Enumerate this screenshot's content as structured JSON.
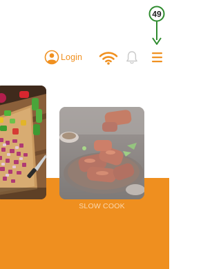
{
  "annotation": {
    "number": "49"
  },
  "header": {
    "login_label": "Login",
    "icons": [
      "user-circle-icon",
      "wifi-icon",
      "bell-icon",
      "hamburger-menu-icon"
    ]
  },
  "cards": [
    {
      "label": ""
    },
    {
      "label": "SLOW COOK"
    }
  ],
  "colors": {
    "accent": "#ef8f1f",
    "annotation": "#2e8b2e",
    "icon_gray": "#c9c9c9",
    "card_label": "#fbd7ad"
  }
}
